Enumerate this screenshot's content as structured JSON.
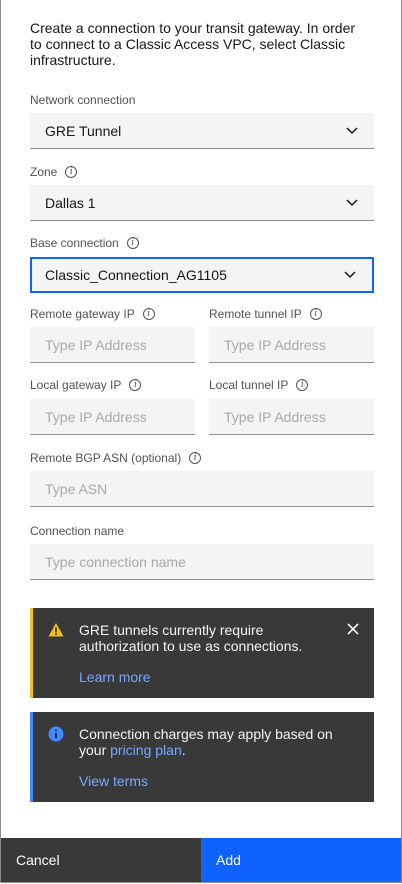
{
  "intro": "Create a connection to your transit gateway. In order to connect to a Classic Access VPC, select Classic infrastructure.",
  "network_connection": {
    "label": "Network connection",
    "value": "GRE Tunnel"
  },
  "zone": {
    "label": "Zone",
    "value": "Dallas 1"
  },
  "base_connection": {
    "label": "Base connection",
    "value": "Classic_Connection_AG1105"
  },
  "remote_gateway_ip": {
    "label": "Remote gateway IP",
    "placeholder": "Type IP Address"
  },
  "remote_tunnel_ip": {
    "label": "Remote tunnel IP",
    "placeholder": "Type IP Address"
  },
  "local_gateway_ip": {
    "label": "Local gateway IP",
    "placeholder": "Type IP Address"
  },
  "local_tunnel_ip": {
    "label": "Local tunnel IP",
    "placeholder": "Type IP Address"
  },
  "remote_bgp_asn": {
    "label": "Remote BGP ASN (optional)",
    "placeholder": "Type ASN"
  },
  "connection_name": {
    "label": "Connection name",
    "placeholder": "Type connection name"
  },
  "warning": {
    "text": "GRE tunnels currently require authorization to use as connections.",
    "link": "Learn more",
    "icon": "warning-icon",
    "color": "#f1c21b"
  },
  "info": {
    "text_before": "Connection charges may apply based on your",
    "link_inline": "pricing plan",
    "text_after": ".",
    "link": "View terms",
    "icon": "info-icon",
    "color": "#4589ff"
  },
  "footer": {
    "cancel": "Cancel",
    "add": "Add"
  },
  "colors": {
    "primary": "#0f62fe",
    "dark": "#393939",
    "field_bg": "#f4f4f4"
  }
}
